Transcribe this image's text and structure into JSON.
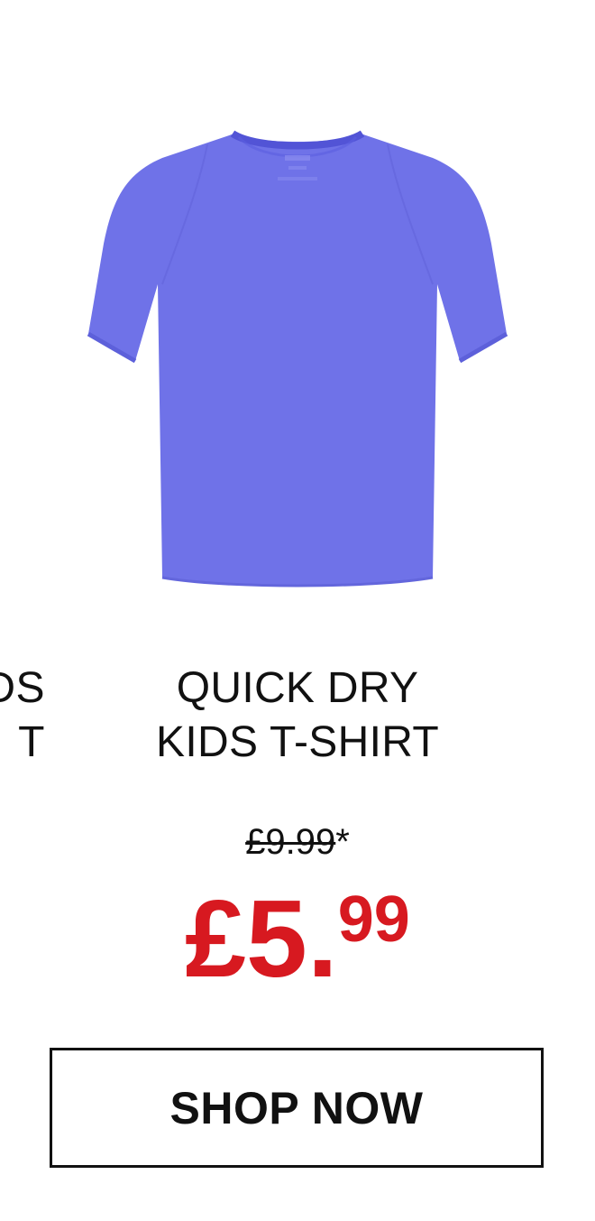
{
  "product": {
    "image_alt": "Quick Dry Kids T-Shirt in purple",
    "image_color": "#6f72e8",
    "title_line1": "QUICK DRY",
    "title_line2": "KIDS T-SHIRT",
    "old_price": "£9.99",
    "old_price_suffix": "*",
    "new_price_main": "£5.",
    "new_price_cents": "99",
    "shop_button_label": "SHOP NOW"
  },
  "previous_product": {
    "title_line1_fragment": "DS",
    "title_line2_fragment": "T"
  },
  "colors": {
    "sale_price": "#d71920",
    "text": "#111111",
    "background": "#ffffff"
  }
}
